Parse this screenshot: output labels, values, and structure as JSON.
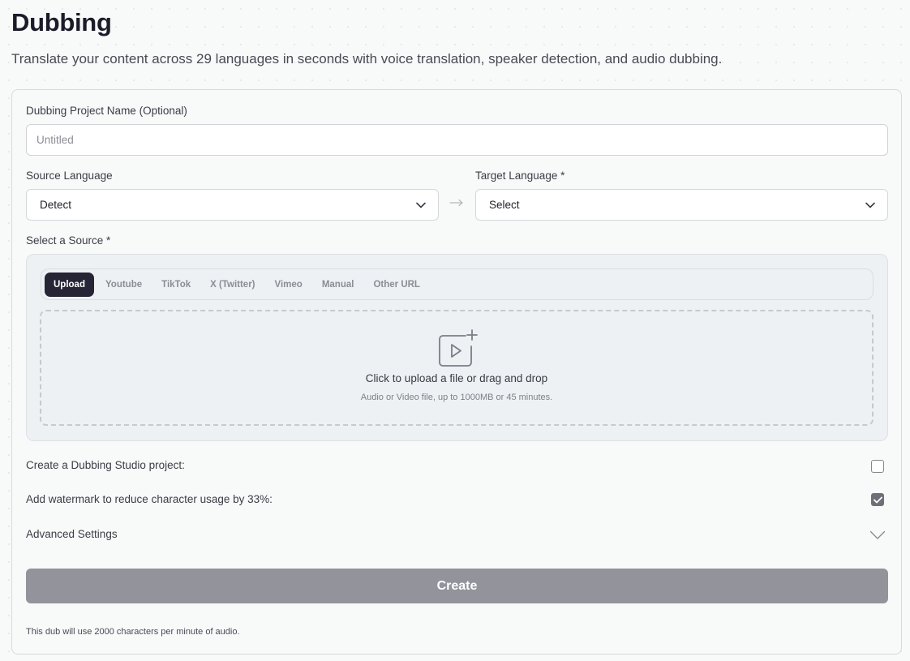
{
  "page": {
    "title": "Dubbing",
    "subtitle": "Translate your content across 29 languages in seconds with voice translation, speaker detection, and audio dubbing."
  },
  "form": {
    "project_name_label": "Dubbing Project Name (Optional)",
    "project_name_placeholder": "Untitled",
    "project_name_value": "",
    "source_language_label": "Source Language",
    "source_language_value": "Detect",
    "target_language_label": "Target Language *",
    "target_language_value": "Select",
    "source_label": "Select a Source *",
    "source_tabs": [
      "Upload",
      "Youtube",
      "TikTok",
      "X (Twitter)",
      "Vimeo",
      "Manual",
      "Other URL"
    ],
    "active_tab": "Upload",
    "upload_main_text": "Click to upload a file or drag and drop",
    "upload_sub_text": "Audio or Video file, up to 1000MB or 45 minutes.",
    "studio_project_label": "Create a Dubbing Studio project:",
    "studio_project_checked": false,
    "watermark_label": "Add watermark to reduce character usage by 33%:",
    "watermark_checked": true,
    "advanced_settings_label": "Advanced Settings",
    "create_button_label": "Create",
    "footnote": "This dub will use 2000 characters per minute of audio."
  },
  "icons": {
    "upload": "video-upload-icon",
    "select_chevron": "chevron-down-icon",
    "language_arrow": "arrow-right-icon",
    "checkmark": "check-icon"
  },
  "colors": {
    "active_tab_bg": "#262536",
    "create_button_bg": "#93939c",
    "checked_checkbox_bg": "#6e6f78"
  }
}
